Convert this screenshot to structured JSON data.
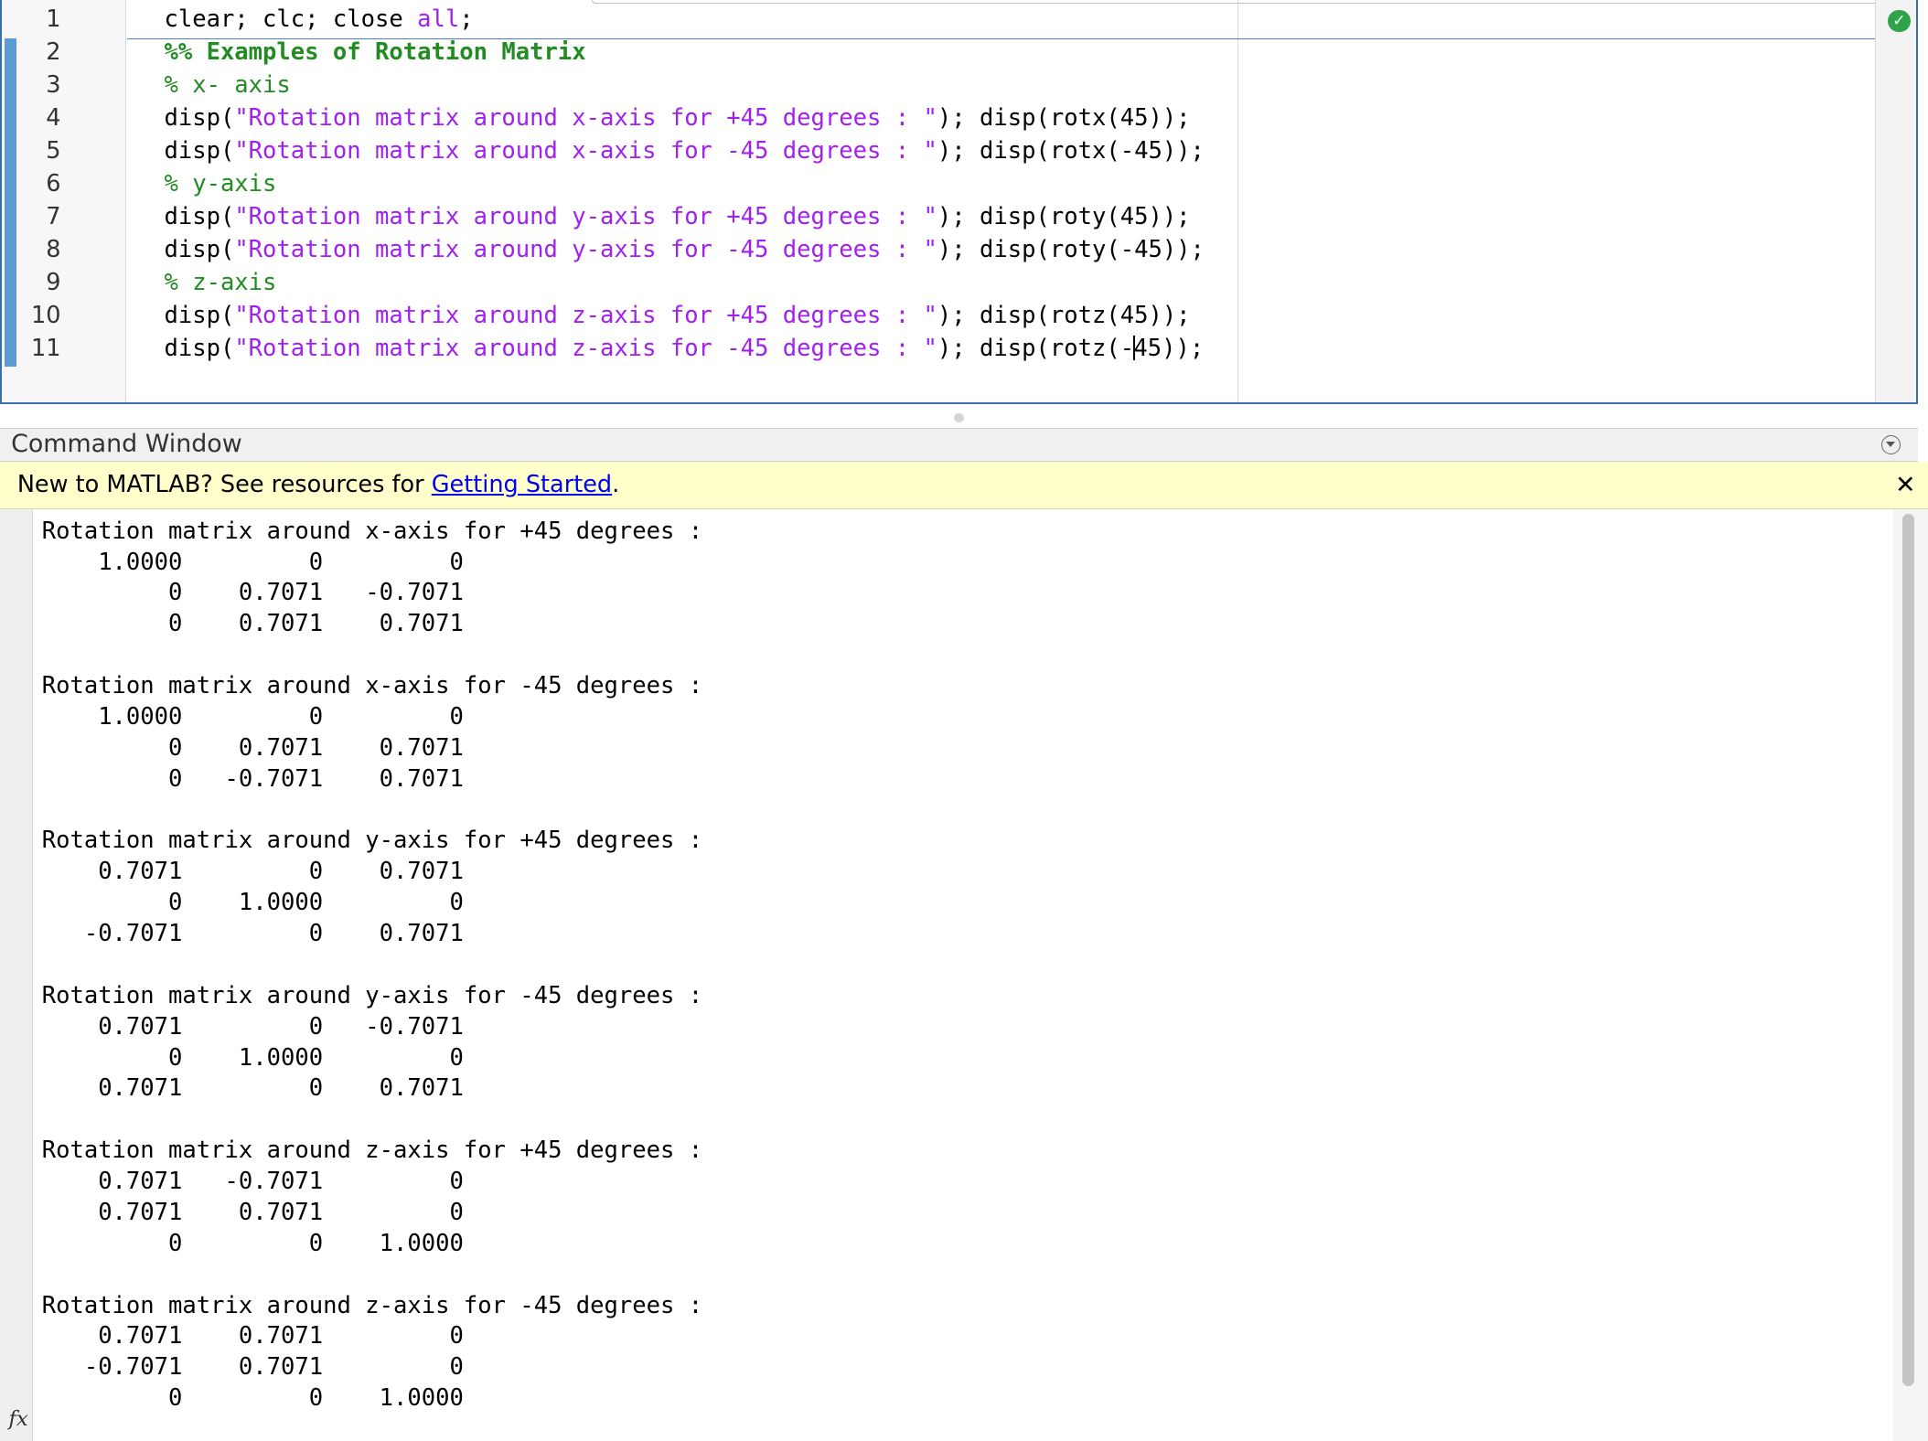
{
  "editor": {
    "lines": [
      {
        "num": "1",
        "parts": [
          {
            "t": "clear; clc; close ",
            "c": ""
          },
          {
            "t": "all",
            "c": "kw2"
          },
          {
            "t": ";",
            "c": ""
          }
        ]
      },
      {
        "num": "2",
        "parts": [
          {
            "t": "%% Examples of Rotation Matrix",
            "c": "cell-title"
          }
        ]
      },
      {
        "num": "3",
        "parts": [
          {
            "t": "% x- axis",
            "c": "cmt"
          }
        ]
      },
      {
        "num": "4",
        "parts": [
          {
            "t": "disp(",
            "c": ""
          },
          {
            "t": "\"Rotation matrix around x-axis for +45 degrees : \"",
            "c": "str"
          },
          {
            "t": "); disp(rotx(45));",
            "c": ""
          }
        ]
      },
      {
        "num": "5",
        "parts": [
          {
            "t": "disp(",
            "c": ""
          },
          {
            "t": "\"Rotation matrix around x-axis for -45 degrees : \"",
            "c": "str"
          },
          {
            "t": "); disp(rotx(-45));",
            "c": ""
          }
        ]
      },
      {
        "num": "6",
        "parts": [
          {
            "t": "% y-axis",
            "c": "cmt"
          }
        ]
      },
      {
        "num": "7",
        "parts": [
          {
            "t": "disp(",
            "c": ""
          },
          {
            "t": "\"Rotation matrix around y-axis for +45 degrees : \"",
            "c": "str"
          },
          {
            "t": "); disp(roty(45));",
            "c": ""
          }
        ]
      },
      {
        "num": "8",
        "parts": [
          {
            "t": "disp(",
            "c": ""
          },
          {
            "t": "\"Rotation matrix around y-axis for -45 degrees : \"",
            "c": "str"
          },
          {
            "t": "); disp(roty(-45));",
            "c": ""
          }
        ]
      },
      {
        "num": "9",
        "parts": [
          {
            "t": "% z-axis",
            "c": "cmt"
          }
        ]
      },
      {
        "num": "10",
        "parts": [
          {
            "t": "disp(",
            "c": ""
          },
          {
            "t": "\"Rotation matrix around z-axis for +45 degrees : \"",
            "c": "str"
          },
          {
            "t": "); disp(rotz(45));",
            "c": ""
          }
        ]
      },
      {
        "num": "11",
        "parts": [
          {
            "t": "disp(",
            "c": ""
          },
          {
            "t": "\"Rotation matrix around z-axis for -45 degrees : \"",
            "c": "str"
          },
          {
            "t": "); disp(rotz(-",
            "c": ""
          },
          {
            "t": "|",
            "c": "cursor"
          },
          {
            "t": "45));",
            "c": ""
          }
        ]
      }
    ],
    "status_icon": "check-icon"
  },
  "command_window": {
    "title": "Command Window",
    "menu_icon": "chevron-down-circle-icon",
    "banner": {
      "prefix": "New to MATLAB? See resources for ",
      "link": "Getting Started",
      "suffix": ".",
      "close_label": "✕"
    },
    "fx_label": "fx",
    "output": [
      {
        "header": "Rotation matrix around x-axis for +45 degrees :",
        "rows": [
          "    1.0000         0         0",
          "         0    0.7071   -0.7071",
          "         0    0.7071    0.7071"
        ]
      },
      {
        "header": "Rotation matrix around x-axis for -45 degrees :",
        "rows": [
          "    1.0000         0         0",
          "         0    0.7071    0.7071",
          "         0   -0.7071    0.7071"
        ]
      },
      {
        "header": "Rotation matrix around y-axis for +45 degrees :",
        "rows": [
          "    0.7071         0    0.7071",
          "         0    1.0000         0",
          "   -0.7071         0    0.7071"
        ]
      },
      {
        "header": "Rotation matrix around y-axis for -45 degrees :",
        "rows": [
          "    0.7071         0   -0.7071",
          "         0    1.0000         0",
          "    0.7071         0    0.7071"
        ]
      },
      {
        "header": "Rotation matrix around z-axis for +45 degrees :",
        "rows": [
          "    0.7071   -0.7071         0",
          "    0.7071    0.7071         0",
          "         0         0    1.0000"
        ]
      },
      {
        "header": "Rotation matrix around z-axis for -45 degrees :",
        "rows": [
          "    0.7071    0.7071         0",
          "   -0.7071    0.7071         0",
          "         0         0    1.0000"
        ]
      }
    ]
  },
  "colors": {
    "editor_border": "#3d6fb0",
    "change_bar": "#5b9bd5",
    "comment": "#228b22",
    "string": "#a020f0",
    "banner_bg": "#ffffcc",
    "link": "#0000ee",
    "ok": "#2ea34a"
  }
}
